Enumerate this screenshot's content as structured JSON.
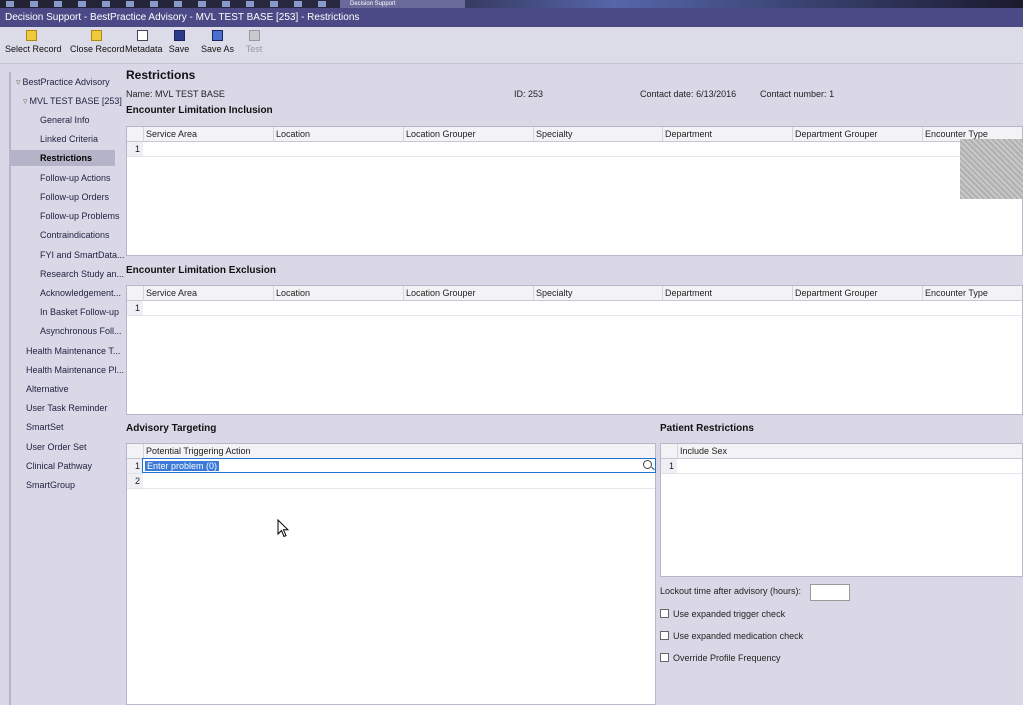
{
  "taskbar": {
    "app_label": "Decision Support"
  },
  "window": {
    "title": "Decision Support - BestPractice Advisory - MVL TEST BASE [253] - Restrictions"
  },
  "toolbar": {
    "buttons": [
      {
        "label": "Select Record",
        "icon": "folder-open-icon"
      },
      {
        "label": "Close Record",
        "icon": "folder-close-icon"
      },
      {
        "label": "Metadata",
        "icon": "metadata-icon"
      },
      {
        "label": "Save",
        "icon": "save-icon"
      },
      {
        "label": "Save As",
        "icon": "save-as-icon"
      },
      {
        "label": "Test",
        "icon": "test-icon",
        "disabled": true
      }
    ]
  },
  "sidebar": {
    "items": [
      {
        "label": "BestPractice Advisory"
      },
      {
        "label": "MVL TEST BASE [253]"
      },
      {
        "label": "General Info"
      },
      {
        "label": "Linked Criteria"
      },
      {
        "label": "Restrictions",
        "active": true
      },
      {
        "label": "Follow-up Actions"
      },
      {
        "label": "Follow-up Orders"
      },
      {
        "label": "Follow-up Problems"
      },
      {
        "label": "Contraindications"
      },
      {
        "label": "FYI and SmartData..."
      },
      {
        "label": "Research Study an..."
      },
      {
        "label": "Acknowledgement..."
      },
      {
        "label": "In Basket Follow-up"
      },
      {
        "label": "Asynchronous Foll..."
      },
      {
        "label": "Health Maintenance T..."
      },
      {
        "label": "Health Maintenance Pl..."
      },
      {
        "label": "Alternative"
      },
      {
        "label": "User Task Reminder"
      },
      {
        "label": "SmartSet"
      },
      {
        "label": "User Order Set"
      },
      {
        "label": "Clinical Pathway"
      },
      {
        "label": "SmartGroup"
      }
    ]
  },
  "main": {
    "title": "Restrictions",
    "name_label": "Name:",
    "name_value": "MVL TEST BASE",
    "id_label": "ID:",
    "id_value": "253",
    "contact_date_label": "Contact date:",
    "contact_date_value": "6/13/2016",
    "contact_number_label": "Contact number:",
    "contact_number_value": "1",
    "inclusion": {
      "title": "Encounter Limitation Inclusion",
      "columns": [
        "Service Area",
        "Location",
        "Location Grouper",
        "Specialty",
        "Department",
        "Department Grouper",
        "Encounter Type"
      ],
      "rows": [
        "1"
      ]
    },
    "exclusion": {
      "title": "Encounter Limitation Exclusion",
      "columns": [
        "Service Area",
        "Location",
        "Location Grouper",
        "Specialty",
        "Department",
        "Department Grouper",
        "Encounter Type"
      ],
      "rows": [
        "1"
      ]
    },
    "targeting": {
      "title": "Advisory Targeting",
      "column": "Potential Triggering Action",
      "rows": [
        "1",
        "2"
      ],
      "edit_placeholder": "Enter problem (0)"
    },
    "patient": {
      "title": "Patient Restrictions",
      "column": "Include Sex",
      "rows": [
        "1"
      ],
      "lockout_label": "Lockout time after advisory (hours):",
      "lockout_value": "",
      "checks": [
        {
          "label": "Use expanded trigger check",
          "checked": false
        },
        {
          "label": "Use expanded medication check",
          "checked": false
        },
        {
          "label": "Override Profile Frequency",
          "checked": false
        }
      ]
    }
  }
}
